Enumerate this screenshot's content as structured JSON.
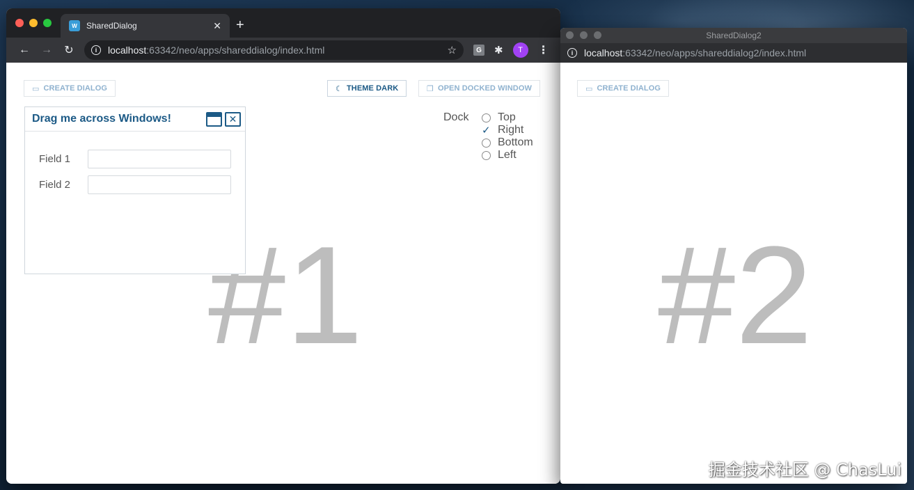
{
  "window1": {
    "tab_title": "SharedDialog",
    "favicon_label": "W",
    "url_host": "localhost",
    "url_rest": ":63342/neo/apps/shareddialog/index.html",
    "extension_g": "G",
    "avatar_letter": "T",
    "toolbar_buttons": {
      "create_dialog": "CREATE DIALOG",
      "theme_dark": "THEME DARK",
      "open_docked_window": "OPEN DOCKED WINDOW"
    },
    "dock": {
      "label": "Dock",
      "options": [
        "Top",
        "Right",
        "Bottom",
        "Left"
      ],
      "selected": "Right"
    },
    "dialog": {
      "title": "Drag me across Windows!",
      "fields": [
        {
          "label": "Field 1",
          "value": ""
        },
        {
          "label": "Field 2",
          "value": ""
        }
      ]
    },
    "big_label": "#1"
  },
  "window2": {
    "title": "SharedDialog2",
    "url_host": "localhost",
    "url_rest": ":63342/neo/apps/shareddialog2/index.html",
    "create_dialog": "CREATE DIALOG",
    "big_label": "#2"
  },
  "watermark": "掘金技术社区 @ ChasLui",
  "colors": {
    "accent": "#1c5a86",
    "muted_button": "#8fb2cf",
    "big_label": "#bdbdbd"
  }
}
